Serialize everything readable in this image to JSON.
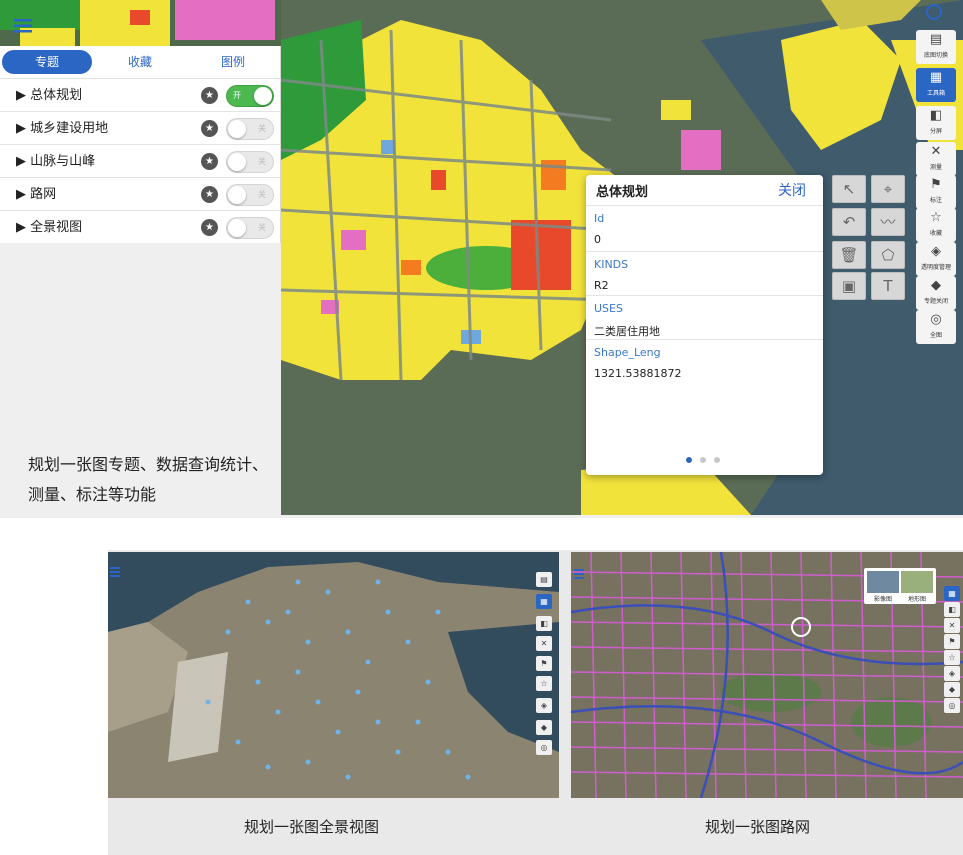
{
  "layer_panel": {
    "tabs": [
      {
        "label": "专题",
        "active": true
      },
      {
        "label": "收藏",
        "active": false
      },
      {
        "label": "图例",
        "active": false
      }
    ],
    "layers": [
      {
        "name": "▶ 总体规划",
        "toggle_text": "开",
        "on": true
      },
      {
        "name": "▶ 城乡建设用地",
        "toggle_text": "关",
        "on": false
      },
      {
        "name": "▶ 山脉与山峰",
        "toggle_text": "关",
        "on": false
      },
      {
        "name": "▶ 路网",
        "toggle_text": "关",
        "on": false
      },
      {
        "name": "▶ 全景视图",
        "toggle_text": "关",
        "on": false
      }
    ]
  },
  "popup": {
    "title": "总体规划",
    "close_label": "关闭",
    "fields": [
      {
        "key": "Id",
        "value": "0"
      },
      {
        "key": "KINDS",
        "value": "R2"
      },
      {
        "key": "USES",
        "value": "二类居住用地"
      },
      {
        "key": "Shape_Leng",
        "value": "1321.53881872"
      }
    ],
    "page_count": 3,
    "active_page": 1
  },
  "side_toolbar": [
    {
      "label": "底图切换",
      "icon": "map-switch-icon",
      "glyph": "▤",
      "active": false
    },
    {
      "label": "工具箱",
      "icon": "toolbox-icon",
      "glyph": "▦",
      "active": true
    },
    {
      "label": "分屏",
      "icon": "split-screen-icon",
      "glyph": "◧",
      "active": false
    },
    {
      "label": "测量",
      "icon": "measure-icon",
      "glyph": "✕",
      "active": false
    },
    {
      "label": "标注",
      "icon": "flag-icon",
      "glyph": "⚑",
      "active": false
    },
    {
      "label": "收藏",
      "icon": "star-icon",
      "glyph": "☆",
      "active": false
    },
    {
      "label": "透明度管理",
      "icon": "opacity-icon",
      "glyph": "◈",
      "active": false
    },
    {
      "label": "专题关闭",
      "icon": "layer-off-icon",
      "glyph": "◆",
      "active": false
    },
    {
      "label": "全图",
      "icon": "full-extent-icon",
      "glyph": "◎",
      "active": false
    }
  ],
  "captions": {
    "top": "规划一张图专题、数据查询统计、测量、标注等功能",
    "bottom_left": "规划一张图全景视图",
    "bottom_right": "规划一张图路网"
  },
  "basemap_thumbs": [
    {
      "label": "影像图"
    },
    {
      "label": "地形图"
    }
  ],
  "colors": {
    "accent": "#2c66c4",
    "toggle_on": "#4cb850",
    "residential": "#f2e33b",
    "commercial": "#e8492a",
    "green_space": "#4caf3c"
  }
}
